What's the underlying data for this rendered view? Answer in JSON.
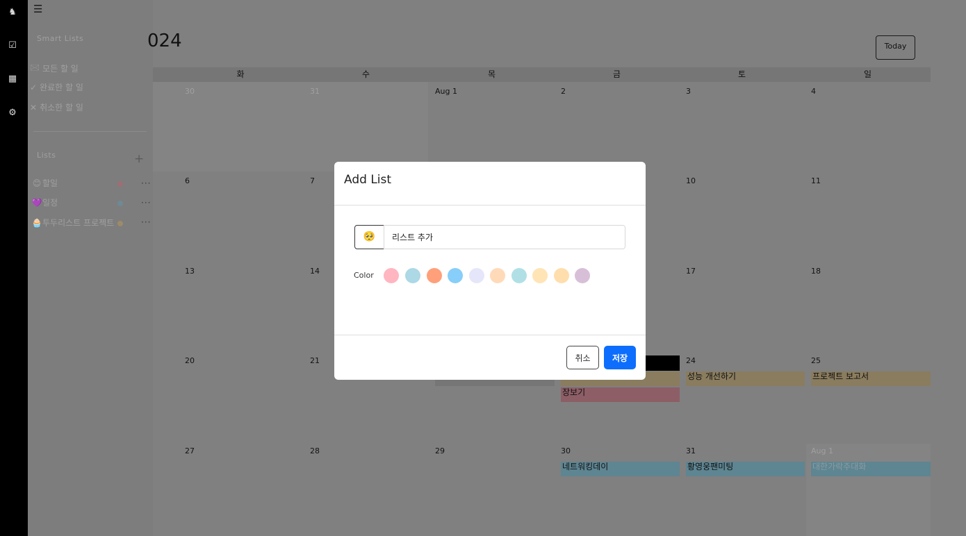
{
  "rail": {
    "icons": [
      "brand-logo-icon",
      "tasks-icon",
      "calendar-icon",
      "settings-icon"
    ]
  },
  "sidebar": {
    "smart_heading": "Smart Lists",
    "smart_items": [
      {
        "icon": "inbox-icon",
        "glyph": "🖂",
        "label": "모든 할 일"
      },
      {
        "icon": "check-icon",
        "glyph": "✓",
        "label": "완료한 할 일"
      },
      {
        "icon": "x-icon",
        "glyph": "✕",
        "label": "취소한 할 일"
      }
    ],
    "lists_heading": "Lists",
    "add_icon": "+",
    "lists": [
      {
        "emoji": "😊",
        "label": "할일",
        "color": "#9c6f74"
      },
      {
        "emoji": "💜",
        "label": "일정",
        "color": "#6d8a95"
      },
      {
        "emoji": "🧁",
        "label": "투두리스트 프로젝트",
        "color": "#9c8b6a"
      }
    ],
    "more_label": "···"
  },
  "calendar": {
    "title": "024",
    "today_label": "Today",
    "day_headers": [
      "화",
      "수",
      "목",
      "금",
      "토",
      "일"
    ],
    "weeks": [
      [
        "30",
        "31",
        "Aug 1",
        "2",
        "3",
        "4"
      ],
      [
        "6",
        "7",
        "",
        "",
        "10",
        "11"
      ],
      [
        "13",
        "14",
        "",
        "",
        "17",
        "18"
      ],
      [
        "20",
        "21",
        "",
        "",
        "24",
        "25"
      ],
      [
        "27",
        "28",
        "29",
        "30",
        "31",
        "Aug 1"
      ]
    ],
    "events": [
      {
        "label": "성능 개선하기",
        "color": "#8a7c5e"
      },
      {
        "label": "프로젝트 보고서",
        "color": "#8a7c5e"
      },
      {
        "label": "장보기",
        "color": "#8d5e66"
      },
      {
        "label": "네트워킹데이",
        "color": "#5e8592"
      },
      {
        "label": "황영웅팬미팅",
        "color": "#5e8592"
      },
      {
        "label": "대한가락주대화",
        "color": "#5e8592"
      }
    ]
  },
  "modal": {
    "title": "Add List",
    "emoji": "🥺",
    "input_value": "리스트 추가",
    "color_label": "Color",
    "colors": [
      "#ffb6c1",
      "#add8e6",
      "#ffa07a",
      "#87cefa",
      "#e6e6fa",
      "#ffdab9",
      "#b0e0e6",
      "#ffe4b5",
      "#ffdead",
      "#d8bfd8"
    ],
    "cancel_label": "취소",
    "save_label": "저장"
  }
}
